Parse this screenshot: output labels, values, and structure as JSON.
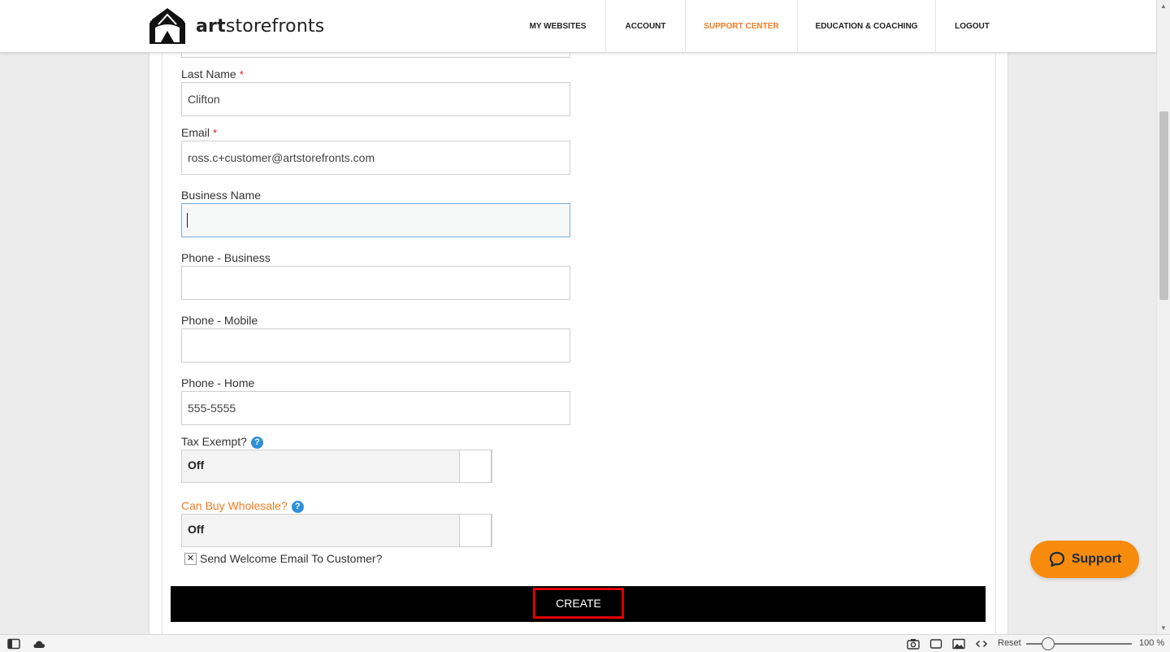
{
  "header": {
    "logo_bold": "art",
    "logo_rest": "storefronts",
    "nav": [
      {
        "label": "MY WEBSITES",
        "active": false
      },
      {
        "label": "ACCOUNT",
        "active": false
      },
      {
        "label": "SUPPORT CENTER",
        "active": true
      },
      {
        "label": "EDUCATION & COACHING",
        "active": false
      },
      {
        "label": "LOGOUT",
        "active": false
      }
    ]
  },
  "form": {
    "last_name": {
      "label": "Last Name",
      "required_mark": "*",
      "value": "Clifton"
    },
    "email": {
      "label": "Email",
      "required_mark": "*",
      "value": "ross.c+customer@artstorefronts.com"
    },
    "business_name": {
      "label": "Business Name",
      "value": ""
    },
    "phone_business": {
      "label": "Phone - Business",
      "value": ""
    },
    "phone_mobile": {
      "label": "Phone - Mobile",
      "value": ""
    },
    "phone_home": {
      "label": "Phone - Home",
      "value": "555-5555"
    },
    "tax_exempt": {
      "label": "Tax Exempt?",
      "help": "?",
      "value": "Off"
    },
    "can_buy_wholesale": {
      "label": "Can Buy Wholesale?",
      "help": "?",
      "value": "Off"
    },
    "send_welcome": {
      "label": "Send Welcome Email To Customer?",
      "mark": "✕"
    },
    "create_label": "CREATE"
  },
  "support_widget": {
    "label": "Support"
  },
  "statusbar": {
    "reset_label": "Reset",
    "zoom": "100 %"
  },
  "colors": {
    "accent": "#f47b20",
    "support_bg": "#f88b0c",
    "required": "#e8141b",
    "help": "#2e8fd7"
  }
}
